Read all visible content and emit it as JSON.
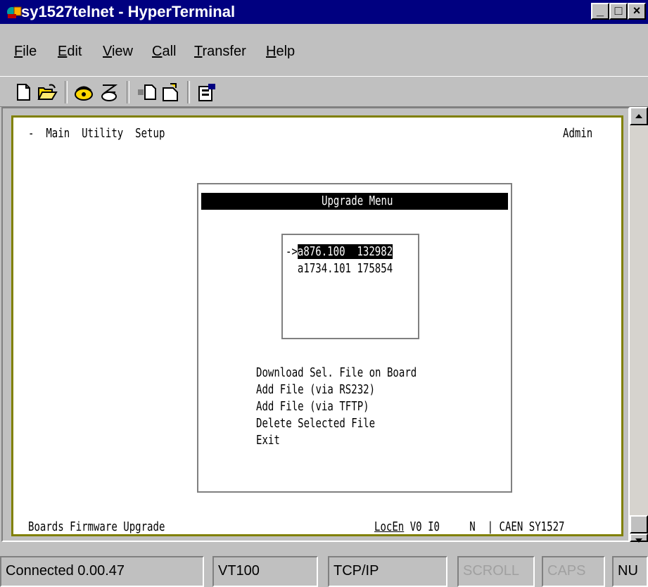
{
  "window": {
    "title": "sy1527telnet - HyperTerminal",
    "controls": {
      "minimize": "_",
      "maximize": "□",
      "close": "×"
    }
  },
  "menubar": [
    {
      "label": "File",
      "accel": "F",
      "rest": "ile"
    },
    {
      "label": "Edit",
      "accel": "E",
      "rest": "dit"
    },
    {
      "label": "View",
      "accel": "V",
      "rest": "iew"
    },
    {
      "label": "Call",
      "accel": "C",
      "rest": "all"
    },
    {
      "label": "Transfer",
      "accel": "T",
      "rest": "ransfer"
    },
    {
      "label": "Help",
      "accel": "H",
      "rest": "elp"
    }
  ],
  "toolbar": {
    "icons": [
      "new-icon",
      "open-icon",
      "connect-icon",
      "disconnect-icon",
      "send-icon",
      "receive-icon",
      "properties-icon"
    ]
  },
  "terminal": {
    "top_menu": "-  Main  Utility  Setup",
    "user": "Admin",
    "dialog_title": "Upgrade Menu",
    "file_list": [
      {
        "pointer": "->",
        "name": "a876.100  132982",
        "selected": true
      },
      {
        "pointer": "  ",
        "name": "a1734.101 175854",
        "selected": false
      }
    ],
    "options": [
      "Download Sel. File on Board",
      "Add File (via RS232)",
      "Add File (via TFTP)",
      "Delete Selected File",
      "Exit"
    ],
    "status_left": "Boards Firmware Upgrade",
    "status_locen": "LocEn",
    "status_mid": " V0 I0     N  | CAEN SY1527"
  },
  "statusbar": {
    "connected": "Connected 0.00.47",
    "emulation": "VT100",
    "protocol": "TCP/IP",
    "scroll": "SCROLL",
    "caps": "CAPS",
    "num": "NU"
  },
  "colors": {
    "titlebar": "#000080",
    "frame": "#c0c0c0",
    "terminal_border": "#808000"
  }
}
